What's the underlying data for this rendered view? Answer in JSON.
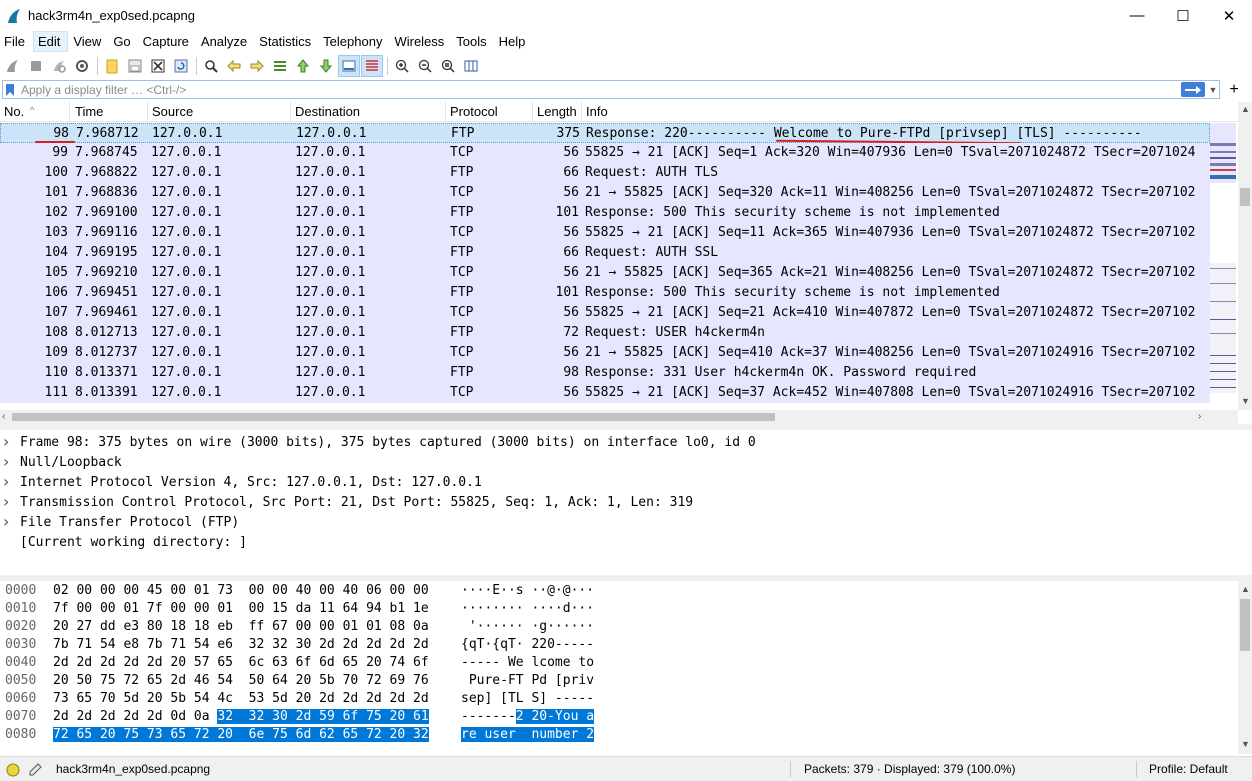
{
  "window": {
    "title": "hack3rm4n_exp0sed.pcapng",
    "minimize": "—",
    "maximize": "☐",
    "close": "✕"
  },
  "menu": [
    "File",
    "Edit",
    "View",
    "Go",
    "Capture",
    "Analyze",
    "Statistics",
    "Telephony",
    "Wireless",
    "Tools",
    "Help"
  ],
  "filter": {
    "placeholder": "Apply a display filter … <Ctrl-/>",
    "value": ""
  },
  "packet_list": {
    "columns": [
      "No.",
      "Time",
      "Source",
      "Destination",
      "Protocol",
      "Length",
      "Info"
    ],
    "rows": [
      {
        "no": "98",
        "time": "7.968712",
        "src": "127.0.0.1",
        "dst": "127.0.0.1",
        "proto": "FTP",
        "len": "375",
        "info": "Response: 220---------- Welcome to Pure-FTPd [privsep] [TLS] ----------",
        "selected": true
      },
      {
        "no": "99",
        "time": "7.968745",
        "src": "127.0.0.1",
        "dst": "127.0.0.1",
        "proto": "TCP",
        "len": "56",
        "info": "55825 → 21 [ACK] Seq=1 Ack=320 Win=407936 Len=0 TSval=2071024872 TSecr=2071024"
      },
      {
        "no": "100",
        "time": "7.968822",
        "src": "127.0.0.1",
        "dst": "127.0.0.1",
        "proto": "FTP",
        "len": "66",
        "info": "Request: AUTH TLS"
      },
      {
        "no": "101",
        "time": "7.968836",
        "src": "127.0.0.1",
        "dst": "127.0.0.1",
        "proto": "TCP",
        "len": "56",
        "info": "21 → 55825 [ACK] Seq=320 Ack=11 Win=408256 Len=0 TSval=2071024872 TSecr=207102"
      },
      {
        "no": "102",
        "time": "7.969100",
        "src": "127.0.0.1",
        "dst": "127.0.0.1",
        "proto": "FTP",
        "len": "101",
        "info": "Response: 500 This security scheme is not implemented"
      },
      {
        "no": "103",
        "time": "7.969116",
        "src": "127.0.0.1",
        "dst": "127.0.0.1",
        "proto": "TCP",
        "len": "56",
        "info": "55825 → 21 [ACK] Seq=11 Ack=365 Win=407936 Len=0 TSval=2071024872 TSecr=207102"
      },
      {
        "no": "104",
        "time": "7.969195",
        "src": "127.0.0.1",
        "dst": "127.0.0.1",
        "proto": "FTP",
        "len": "66",
        "info": "Request: AUTH SSL"
      },
      {
        "no": "105",
        "time": "7.969210",
        "src": "127.0.0.1",
        "dst": "127.0.0.1",
        "proto": "TCP",
        "len": "56",
        "info": "21 → 55825 [ACK] Seq=365 Ack=21 Win=408256 Len=0 TSval=2071024872 TSecr=207102"
      },
      {
        "no": "106",
        "time": "7.969451",
        "src": "127.0.0.1",
        "dst": "127.0.0.1",
        "proto": "FTP",
        "len": "101",
        "info": "Response: 500 This security scheme is not implemented"
      },
      {
        "no": "107",
        "time": "7.969461",
        "src": "127.0.0.1",
        "dst": "127.0.0.1",
        "proto": "TCP",
        "len": "56",
        "info": "55825 → 21 [ACK] Seq=21 Ack=410 Win=407872 Len=0 TSval=2071024872 TSecr=207102"
      },
      {
        "no": "108",
        "time": "8.012713",
        "src": "127.0.0.1",
        "dst": "127.0.0.1",
        "proto": "FTP",
        "len": "72",
        "info": "Request: USER h4ckerm4n"
      },
      {
        "no": "109",
        "time": "8.012737",
        "src": "127.0.0.1",
        "dst": "127.0.0.1",
        "proto": "TCP",
        "len": "56",
        "info": "21 → 55825 [ACK] Seq=410 Ack=37 Win=408256 Len=0 TSval=2071024916 TSecr=207102"
      },
      {
        "no": "110",
        "time": "8.013371",
        "src": "127.0.0.1",
        "dst": "127.0.0.1",
        "proto": "FTP",
        "len": "98",
        "info": "Response: 331 User h4ckerm4n OK. Password required"
      },
      {
        "no": "111",
        "time": "8.013391",
        "src": "127.0.0.1",
        "dst": "127.0.0.1",
        "proto": "TCP",
        "len": "56",
        "info": "55825 → 21 [ACK] Seq=37 Ack=452 Win=407808 Len=0 TSval=2071024916 TSecr=207102"
      }
    ]
  },
  "details": [
    {
      "text": "Frame 98: 375 bytes on wire (3000 bits), 375 bytes captured (3000 bits) on interface lo0, id 0",
      "expandable": true
    },
    {
      "text": "Null/Loopback",
      "expandable": true
    },
    {
      "text": "Internet Protocol Version 4, Src: 127.0.0.1, Dst: 127.0.0.1",
      "expandable": true
    },
    {
      "text": "Transmission Control Protocol, Src Port: 21, Dst Port: 55825, Seq: 1, Ack: 1, Len: 319",
      "expandable": true
    },
    {
      "text": "File Transfer Protocol (FTP)",
      "expandable": true
    },
    {
      "text": "[Current working directory: ]",
      "expandable": false
    }
  ],
  "bytes": [
    {
      "offset": "0000",
      "hex_plain": "02 00 00 00 45 00 01 73  00 00 40 00 40 06 00 00",
      "hex_hl": "",
      "ascii_plain": "····E··s ··@·@···",
      "ascii_hl": ""
    },
    {
      "offset": "0010",
      "hex_plain": "7f 00 00 01 7f 00 00 01  00 15 da 11 64 94 b1 1e",
      "hex_hl": "",
      "ascii_plain": "········ ····d···",
      "ascii_hl": ""
    },
    {
      "offset": "0020",
      "hex_plain": "20 27 dd e3 80 18 18 eb  ff 67 00 00 01 01 08 0a",
      "hex_hl": "",
      "ascii_plain": " '······ ·g······",
      "ascii_hl": ""
    },
    {
      "offset": "0030",
      "hex_plain": "7b 71 54 e8 7b 71 54 e6  32 32 30 2d 2d 2d 2d 2d",
      "hex_hl": "",
      "ascii_plain": "{qT·{qT· 220-----",
      "ascii_hl": ""
    },
    {
      "offset": "0040",
      "hex_plain": "2d 2d 2d 2d 2d 20 57 65  6c 63 6f 6d 65 20 74 6f",
      "hex_hl": "",
      "ascii_plain": "----- We lcome to",
      "ascii_hl": ""
    },
    {
      "offset": "0050",
      "hex_plain": "20 50 75 72 65 2d 46 54  50 64 20 5b 70 72 69 76",
      "hex_hl": "",
      "ascii_plain": " Pure-FT Pd [priv",
      "ascii_hl": ""
    },
    {
      "offset": "0060",
      "hex_plain": "73 65 70 5d 20 5b 54 4c  53 5d 20 2d 2d 2d 2d 2d",
      "hex_hl": "",
      "ascii_plain": "sep] [TL S] -----",
      "ascii_hl": ""
    },
    {
      "offset": "0070",
      "hex_plain": "2d 2d 2d 2d 2d 0d 0a ",
      "hex_hl": "32  32 30 2d 59 6f 75 20 61",
      "ascii_plain": "-------",
      "ascii_hl": "2 20-You a"
    },
    {
      "offset": "0080",
      "hex_plain": "",
      "hex_hl": "72 65 20 75 73 65 72 20  6e 75 6d 62 65 72 20 32",
      "ascii_plain": "",
      "ascii_hl": "re user  number 2"
    }
  ],
  "status": {
    "file": "hack3rm4n_exp0sed.pcapng",
    "packets": "Packets: 379 · Displayed: 379 (100.0%)",
    "profile": "Profile: Default"
  },
  "colors": {
    "tcp_row": "#e7e6ff",
    "selected_row": "#cce4f7",
    "byte_highlight": "#0078d7",
    "annotation_red": "#d42020"
  }
}
